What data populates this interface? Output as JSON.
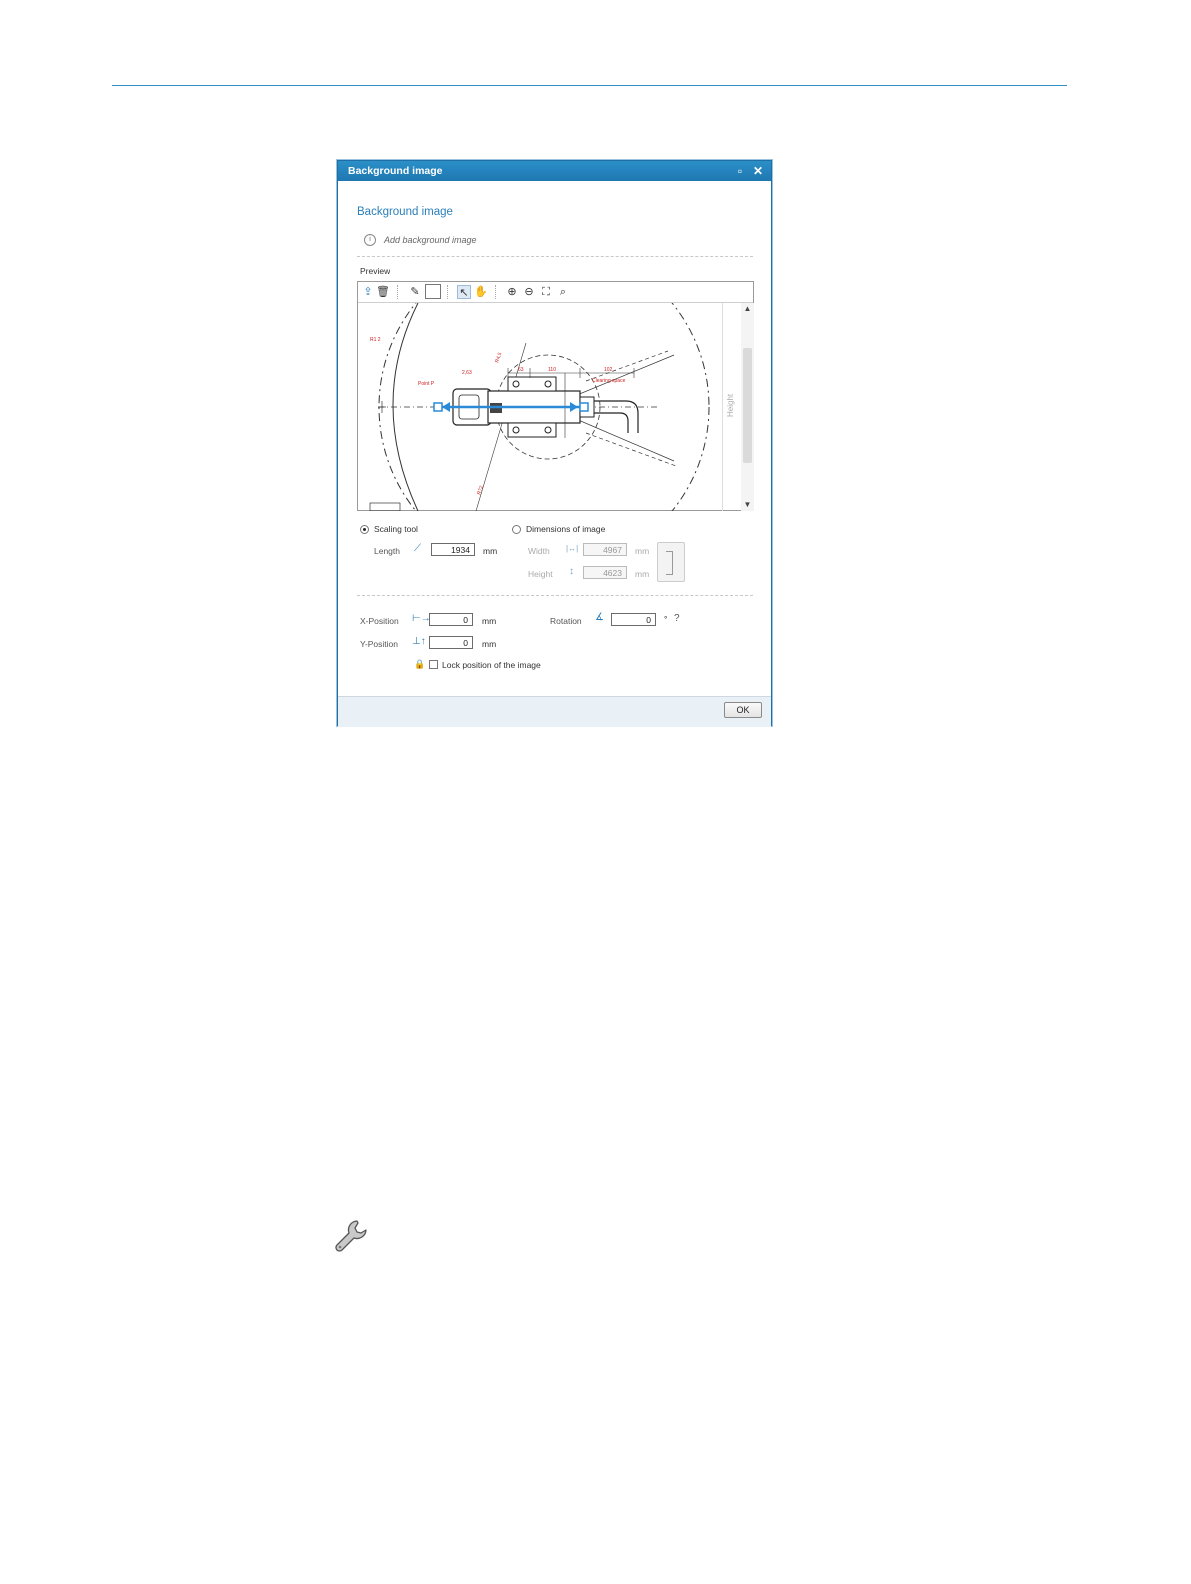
{
  "dialog": {
    "title": "Background image",
    "heading": "Background image",
    "info_text": "Add background image",
    "preview_label": "Preview",
    "ruler_label": "Height",
    "scaling": {
      "option_scaling_tool": "Scaling tool",
      "option_dimensions": "Dimensions of image",
      "selected": "Scaling tool",
      "length_label": "Length",
      "length_value": "1934",
      "length_unit": "mm",
      "width_label": "Width",
      "width_value": "4967",
      "width_unit": "mm",
      "height_label": "Height",
      "height_value": "4623",
      "height_unit": "mm"
    },
    "position": {
      "x_label": "X-Position",
      "x_value": "0",
      "x_unit": "mm",
      "y_label": "Y-Position",
      "y_value": "0",
      "y_unit": "mm",
      "rotation_label": "Rotation",
      "rotation_value": "0",
      "rotation_unit": "°",
      "lock_label": "Lock position of the image",
      "lock_checked": false
    },
    "ok_label": "OK"
  },
  "drawing": {
    "labels": {
      "point_p": "Point P",
      "clearing_space": "Clearing space",
      "dim_a": "2,63",
      "dim_b": "63",
      "dim_c": "110",
      "dim_d": "102",
      "dim_e": "R1 2",
      "dim_f": "R4,5",
      "dim_g": "R72"
    },
    "colors": {
      "accent": "#2a7fb8",
      "red": "#cc2222",
      "blue_arrow": "#2a8ad8"
    }
  }
}
